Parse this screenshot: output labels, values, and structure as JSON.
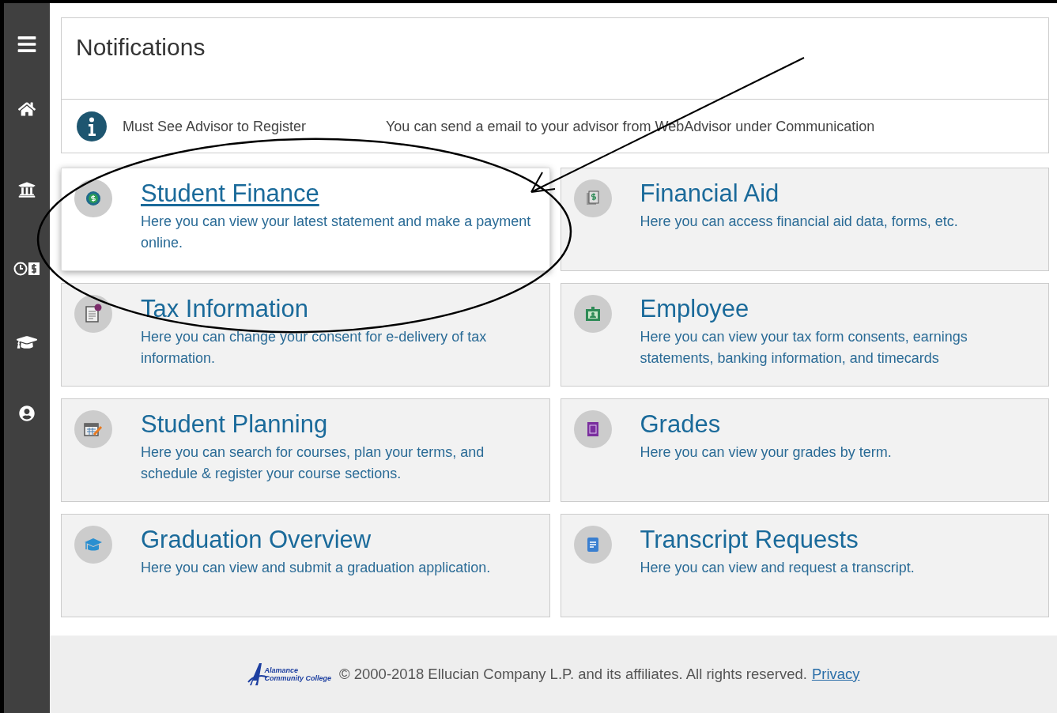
{
  "sidebar": {
    "items": [
      {
        "kind": "menu"
      },
      {
        "kind": "home"
      },
      {
        "kind": "bank"
      },
      {
        "kind": "finance"
      },
      {
        "kind": "graduation"
      },
      {
        "kind": "user"
      }
    ]
  },
  "notifications": {
    "title": "Notifications",
    "items": [
      {
        "message": "Must See Advisor to Register",
        "details": "You can send a email to your advisor from WebAdvisor under Communication"
      }
    ]
  },
  "tiles": [
    {
      "kind": "finance",
      "title": "Student Finance",
      "description": "Here you can view your latest statement and make a payment online.",
      "selected": true
    },
    {
      "kind": "aid",
      "title": "Financial Aid",
      "description": "Here you can access financial aid data, forms, etc.",
      "selected": false
    },
    {
      "kind": "tax",
      "title": "Tax Information",
      "description": "Here you can change your consent for e-delivery of tax information.",
      "selected": false
    },
    {
      "kind": "employee",
      "title": "Employee",
      "description": "Here you can view your tax form consents, earnings statements, banking information, and timecards",
      "selected": false
    },
    {
      "kind": "planning",
      "title": "Student Planning",
      "description": "Here you can search for courses, plan your terms, and schedule & register your course sections.",
      "selected": false
    },
    {
      "kind": "grades",
      "title": "Grades",
      "description": "Here you can view your grades by term.",
      "selected": false
    },
    {
      "kind": "graduation",
      "title": "Graduation Overview",
      "description": "Here you can view and submit a graduation application.",
      "selected": false
    },
    {
      "kind": "transcript",
      "title": "Transcript Requests",
      "description": "Here you can view and request a transcript.",
      "selected": false
    }
  ],
  "footer": {
    "logo_lines": [
      "Alamance",
      "Community College"
    ],
    "copyright": "© 2000-2018 Ellucian Company L.P. and its affiliates. All rights reserved.",
    "link": "Privacy"
  }
}
